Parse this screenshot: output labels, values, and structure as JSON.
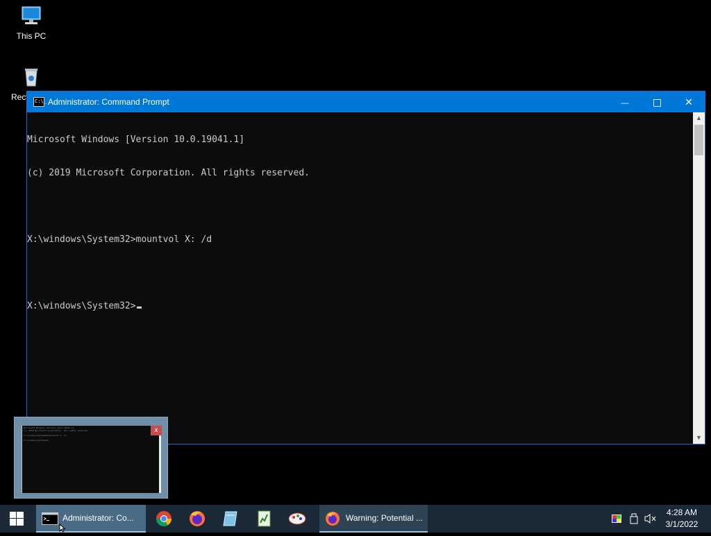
{
  "desktop": {
    "icons": [
      {
        "label": "This PC"
      },
      {
        "label": "Recy"
      }
    ]
  },
  "cmd_window": {
    "title": "Administrator: Command Prompt",
    "icon_text": "C:\\_",
    "controls": {
      "minimize": "—",
      "close": "✕"
    },
    "lines": [
      "Microsoft Windows [Version 10.0.19041.1]",
      "(c) 2019 Microsoft Corporation. All rights reserved.",
      "",
      "X:\\windows\\System32>mountvol X: /d",
      "",
      "X:\\windows\\System32>"
    ],
    "scrollbar": {
      "up": "▲",
      "down": "▼"
    }
  },
  "thumbnail": {
    "close": "x",
    "lines": [
      "Microsoft Windows [Version 10.0.19041.1]",
      "(c) 2019 Microsoft Corporation. All rights reserved.",
      "",
      "X:\\windows\\System32>mountvol X: /d",
      "",
      "X:\\windows\\System32>"
    ]
  },
  "taskbar": {
    "tasks": [
      {
        "label": "Administrator: Co..."
      },
      {
        "label": "Warning: Potential ..."
      }
    ],
    "pinned": [
      "chrome-icon",
      "firefox-icon",
      "notepad-icon",
      "spreadsheet-icon",
      "paint-icon"
    ],
    "clock": {
      "time": "4:28 AM",
      "date": "3/1/2022"
    }
  },
  "colors": {
    "titlebar": "#0078d7",
    "console_bg": "#0c0c0c",
    "console_text": "#cccccc",
    "taskbar": "#1b2a36"
  }
}
